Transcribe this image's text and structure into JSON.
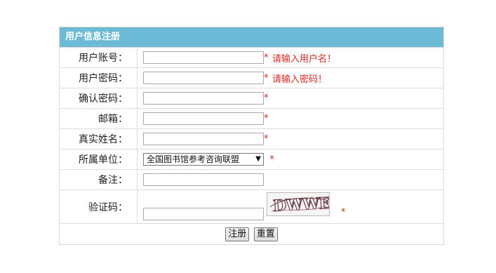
{
  "form": {
    "title": "用户信息注册",
    "fields": {
      "username": {
        "label": "用户账号：",
        "value": "",
        "required_mark": "*",
        "message": "请输入用户名！"
      },
      "password": {
        "label": "用户密码：",
        "value": "",
        "required_mark": "*",
        "message": "请输入密码！"
      },
      "confirm_password": {
        "label": "确认密码：",
        "value": "",
        "required_mark": "*"
      },
      "email": {
        "label": "邮箱：",
        "value": "",
        "required_mark": "*"
      },
      "real_name": {
        "label": "真实姓名：",
        "value": "",
        "required_mark": "*"
      },
      "unit": {
        "label": "所属单位：",
        "selected": "全国图书馆参考咨询联盟",
        "required_mark": "*"
      },
      "notes": {
        "label": "备注：",
        "value": ""
      },
      "captcha": {
        "label": "验证码：",
        "value": "",
        "image_text": "DWWE",
        "required_mark": "*"
      }
    },
    "buttons": {
      "register": "注册",
      "reset": "重置"
    }
  },
  "colors": {
    "header_bg": "#6dbad6",
    "required": "#d32b1f"
  }
}
